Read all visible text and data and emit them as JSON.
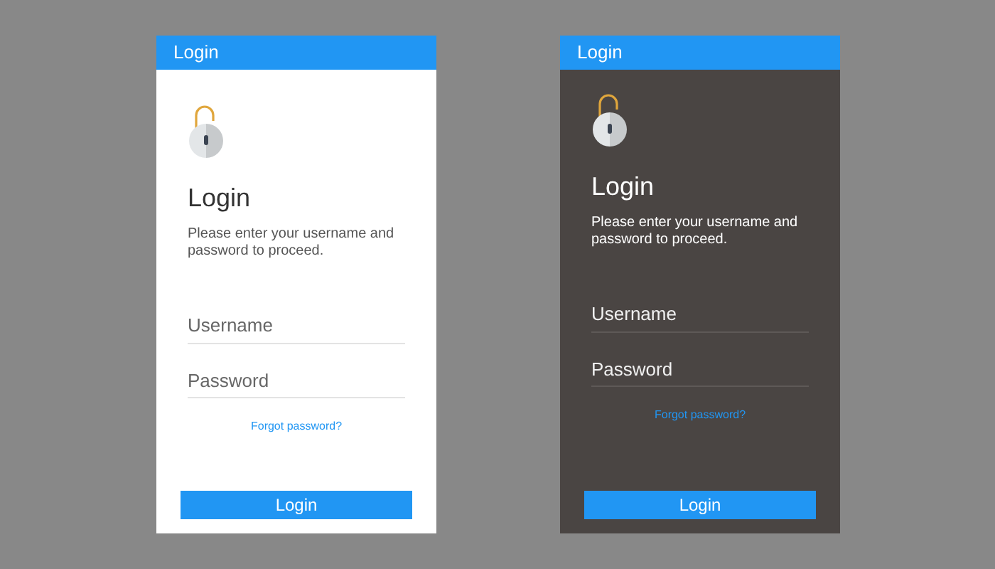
{
  "screens": [
    {
      "kind": "light",
      "title": "Login",
      "heading": "Login",
      "description": "Please enter your username and password to proceed.",
      "username": {
        "placeholder": "Username"
      },
      "password": {
        "placeholder": "Password"
      },
      "forgot_link": "Forgot password?",
      "submit": "Login"
    },
    {
      "kind": "dark",
      "title": "Login",
      "heading": "Login",
      "description": "Please enter your username and password to proceed.",
      "username": {
        "placeholder": "Username"
      },
      "password": {
        "placeholder": "Password"
      },
      "forgot_link": "Forgot password?",
      "submit": "Login"
    }
  ]
}
